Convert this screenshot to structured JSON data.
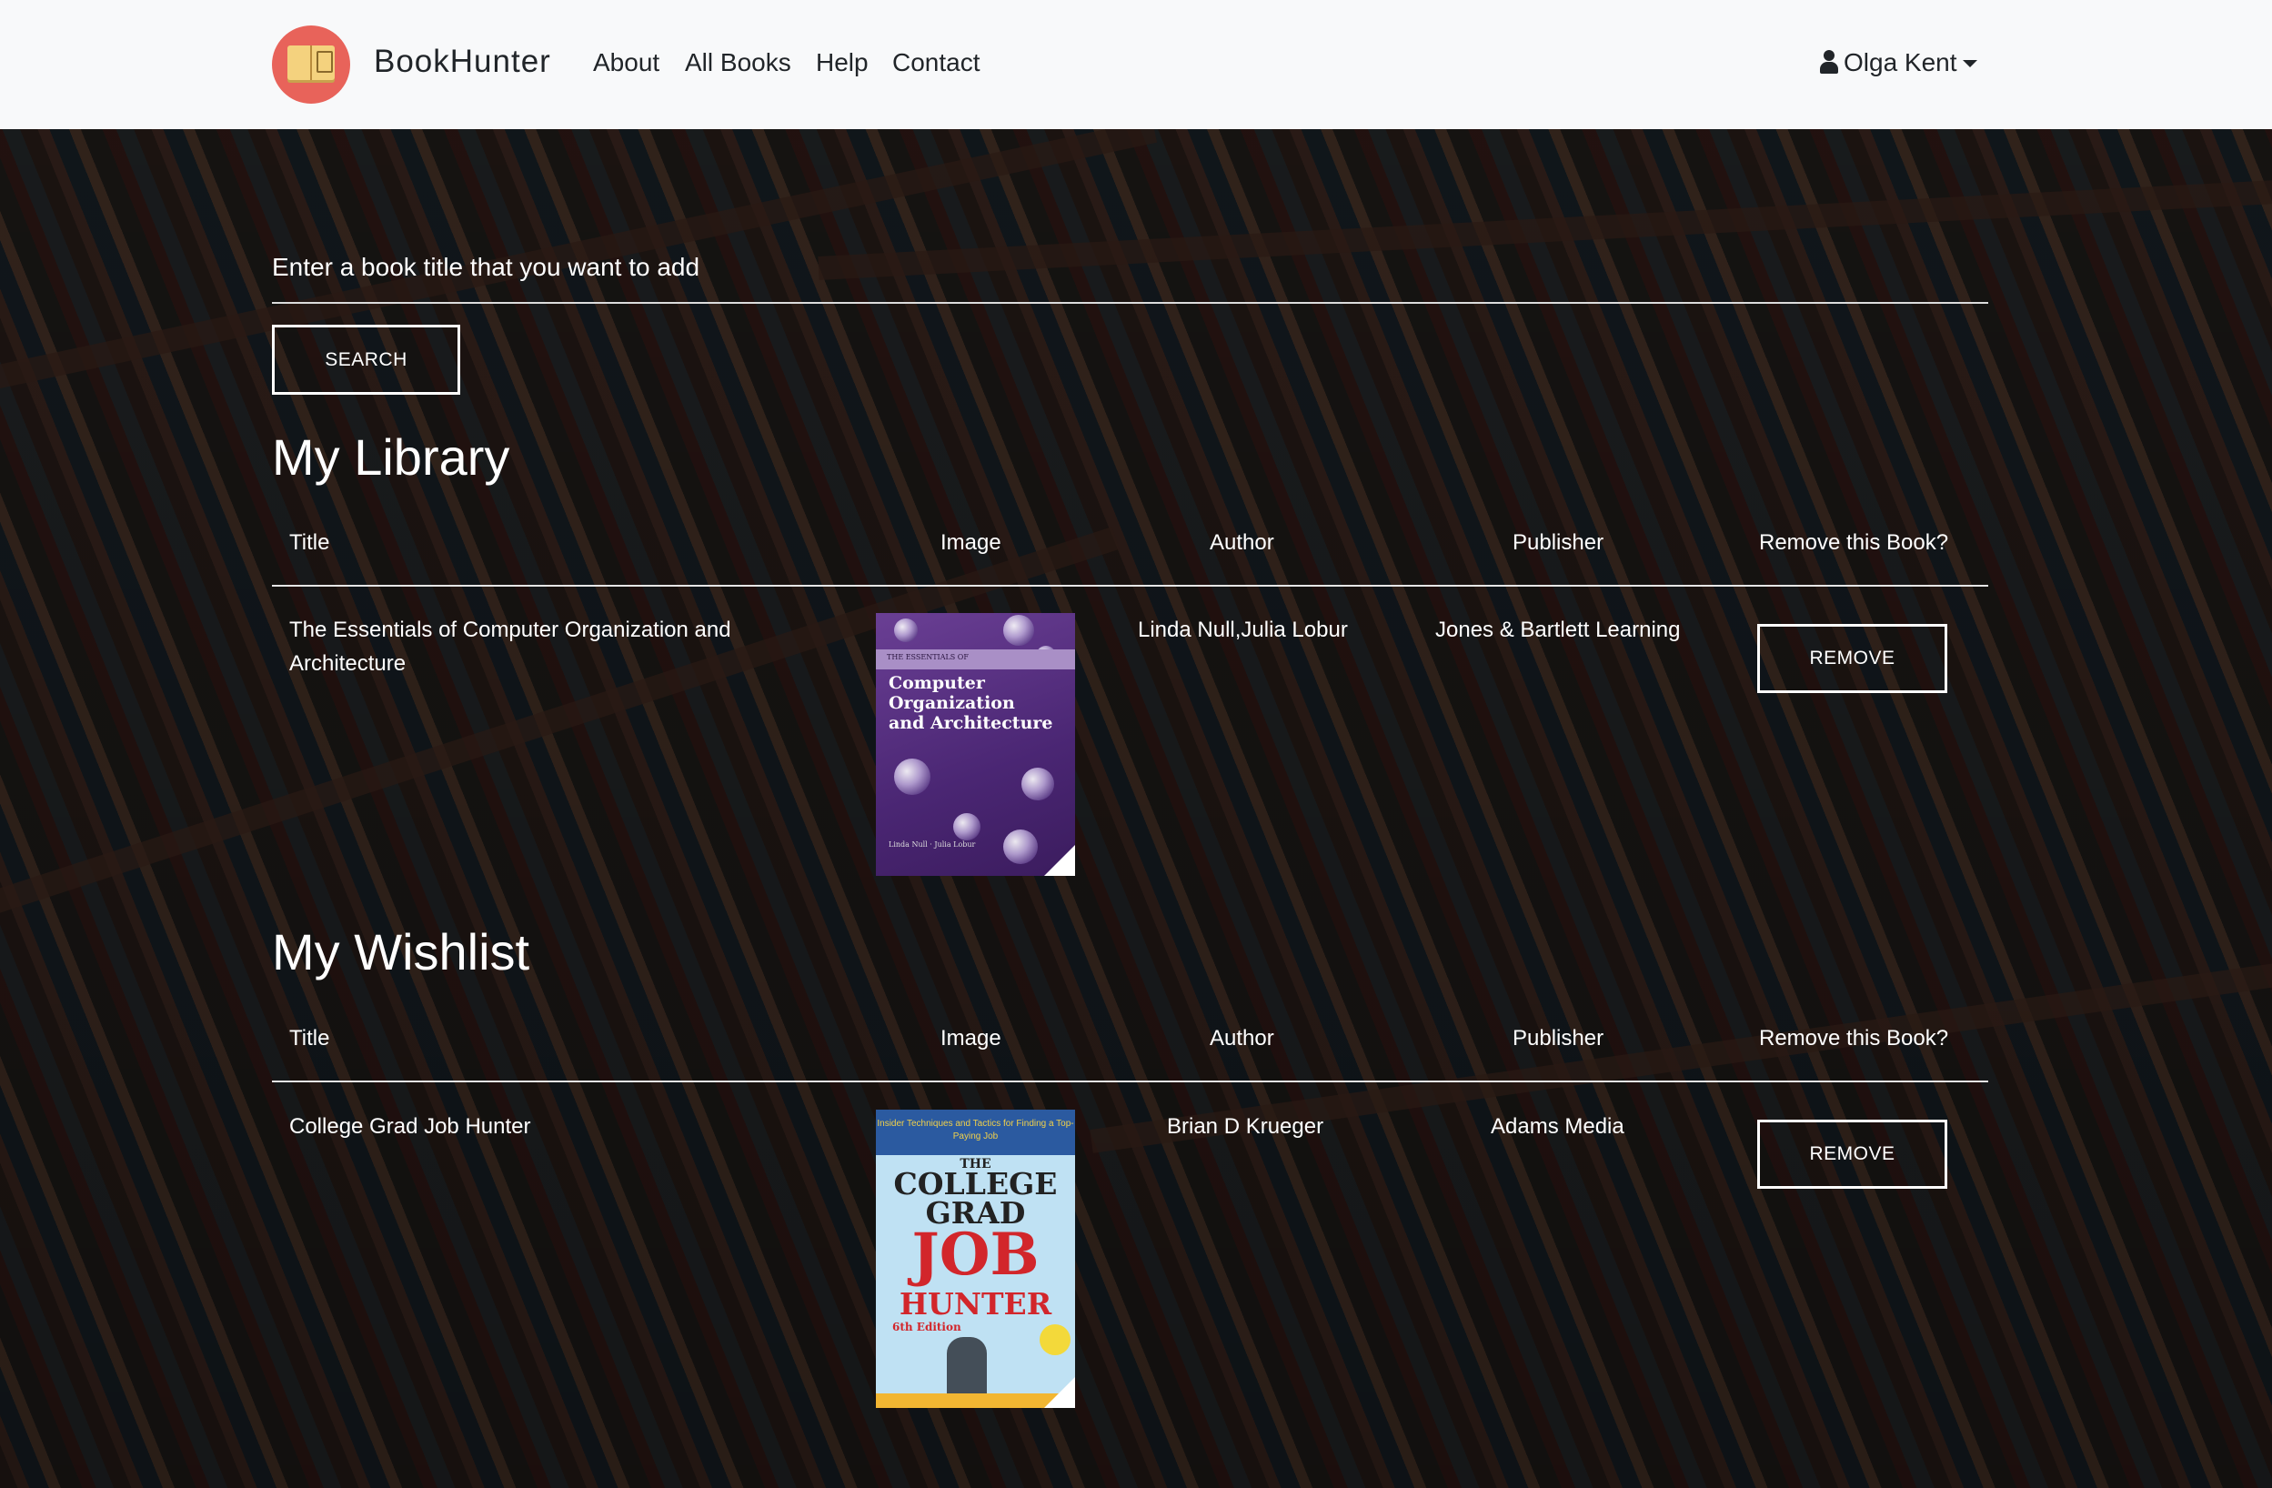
{
  "navbar": {
    "brand": "BookHunter",
    "links": [
      "About",
      "All Books",
      "Help",
      "Contact"
    ],
    "user": "Olga Kent"
  },
  "search": {
    "label": "Enter a book title that you want to add",
    "button": "SEARCH"
  },
  "library": {
    "title": "My Library",
    "columns": [
      "Title",
      "Image",
      "Author",
      "Publisher",
      "Remove this Book?"
    ],
    "rows": [
      {
        "title": "The Essentials of Computer Organization and Architecture",
        "author": "Linda Null,Julia Lobur",
        "publisher": "Jones & Bartlett Learning",
        "button": "REMOVE",
        "cover": {
          "series": "THE ESSENTIALS OF",
          "title_lines": [
            "Computer",
            "Organization",
            "and Architecture"
          ],
          "authors": "Linda Null · Julia Lobur"
        }
      }
    ]
  },
  "wishlist": {
    "title": "My Wishlist",
    "columns": [
      "Title",
      "Image",
      "Author",
      "Publisher",
      "Remove this Book?"
    ],
    "rows": [
      {
        "title": "College Grad Job Hunter",
        "author": "Brian D Krueger",
        "publisher": "Adams Media",
        "button": "REMOVE",
        "cover": {
          "tagline": "Insider Techniques and Tactics for Finding a Top-Paying Job",
          "the": "THE",
          "college_grad": "COLLEGE GRAD",
          "job": "JOB",
          "hunter": "HUNTER",
          "edition": "6th Edition"
        }
      }
    ]
  },
  "colors": {
    "navbar_bg": "#f8f9fa",
    "logo_bg": "#e8635a",
    "text": "#ffffff"
  }
}
